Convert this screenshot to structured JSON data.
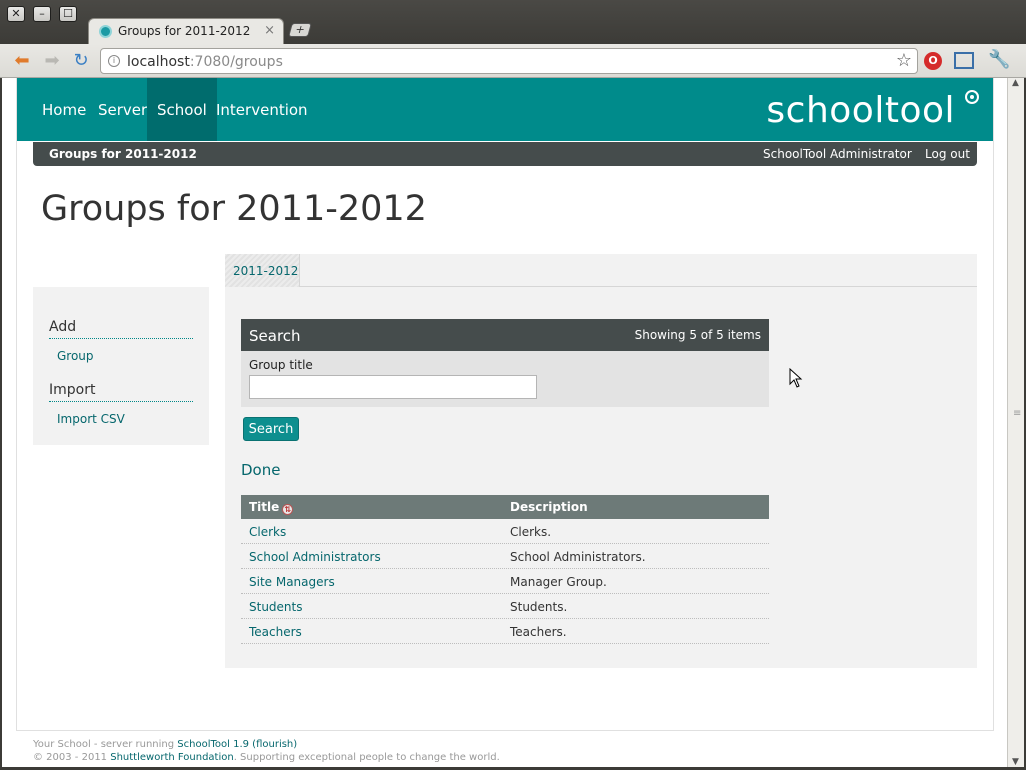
{
  "browser": {
    "tab_title": "Groups for 2011-2012",
    "tab_close": "×",
    "new_tab": "+",
    "url_host": "localhost",
    "url_path": ":7080/groups",
    "window_close": "✕",
    "window_min": "–",
    "window_max": "☐"
  },
  "topnav": {
    "items": [
      {
        "label": "Home"
      },
      {
        "label": "Server"
      },
      {
        "label": "School"
      },
      {
        "label": "Intervention"
      }
    ],
    "active_index": 2,
    "brand": "schooltool"
  },
  "subbar": {
    "breadcrumb": "Groups for 2011-2012",
    "user": "SchoolTool Administrator",
    "logout": "Log out"
  },
  "page": {
    "title": "Groups for 2011-2012"
  },
  "sidebar": {
    "add_heading": "Add",
    "add_link": "Group",
    "import_heading": "Import",
    "import_link": "Import CSV"
  },
  "content": {
    "year_tab": "2011-2012",
    "search": {
      "heading": "Search",
      "count": "Showing 5 of 5 items",
      "field_label": "Group title",
      "field_value": "",
      "button": "Search"
    },
    "done": "Done",
    "table": {
      "columns": [
        "Title",
        "Description"
      ],
      "rows": [
        {
          "title": "Clerks",
          "description": "Clerks."
        },
        {
          "title": "School Administrators",
          "description": "School Administrators."
        },
        {
          "title": "Site Managers",
          "description": "Manager Group."
        },
        {
          "title": "Students",
          "description": "Students."
        },
        {
          "title": "Teachers",
          "description": "Teachers."
        }
      ]
    }
  },
  "footer": {
    "line1_prefix": "Your School - server running ",
    "line1_link": "SchoolTool 1.9 (flourish)",
    "line2_prefix": "© 2003 - 2011 ",
    "line2_link": "Shuttleworth Foundation",
    "line2_suffix": ". Supporting exceptional people to change the world."
  },
  "colors": {
    "brand_teal": "#008b8b",
    "active_nav": "#006c6d",
    "dark_bar": "#454c4c",
    "link": "#06676d"
  }
}
